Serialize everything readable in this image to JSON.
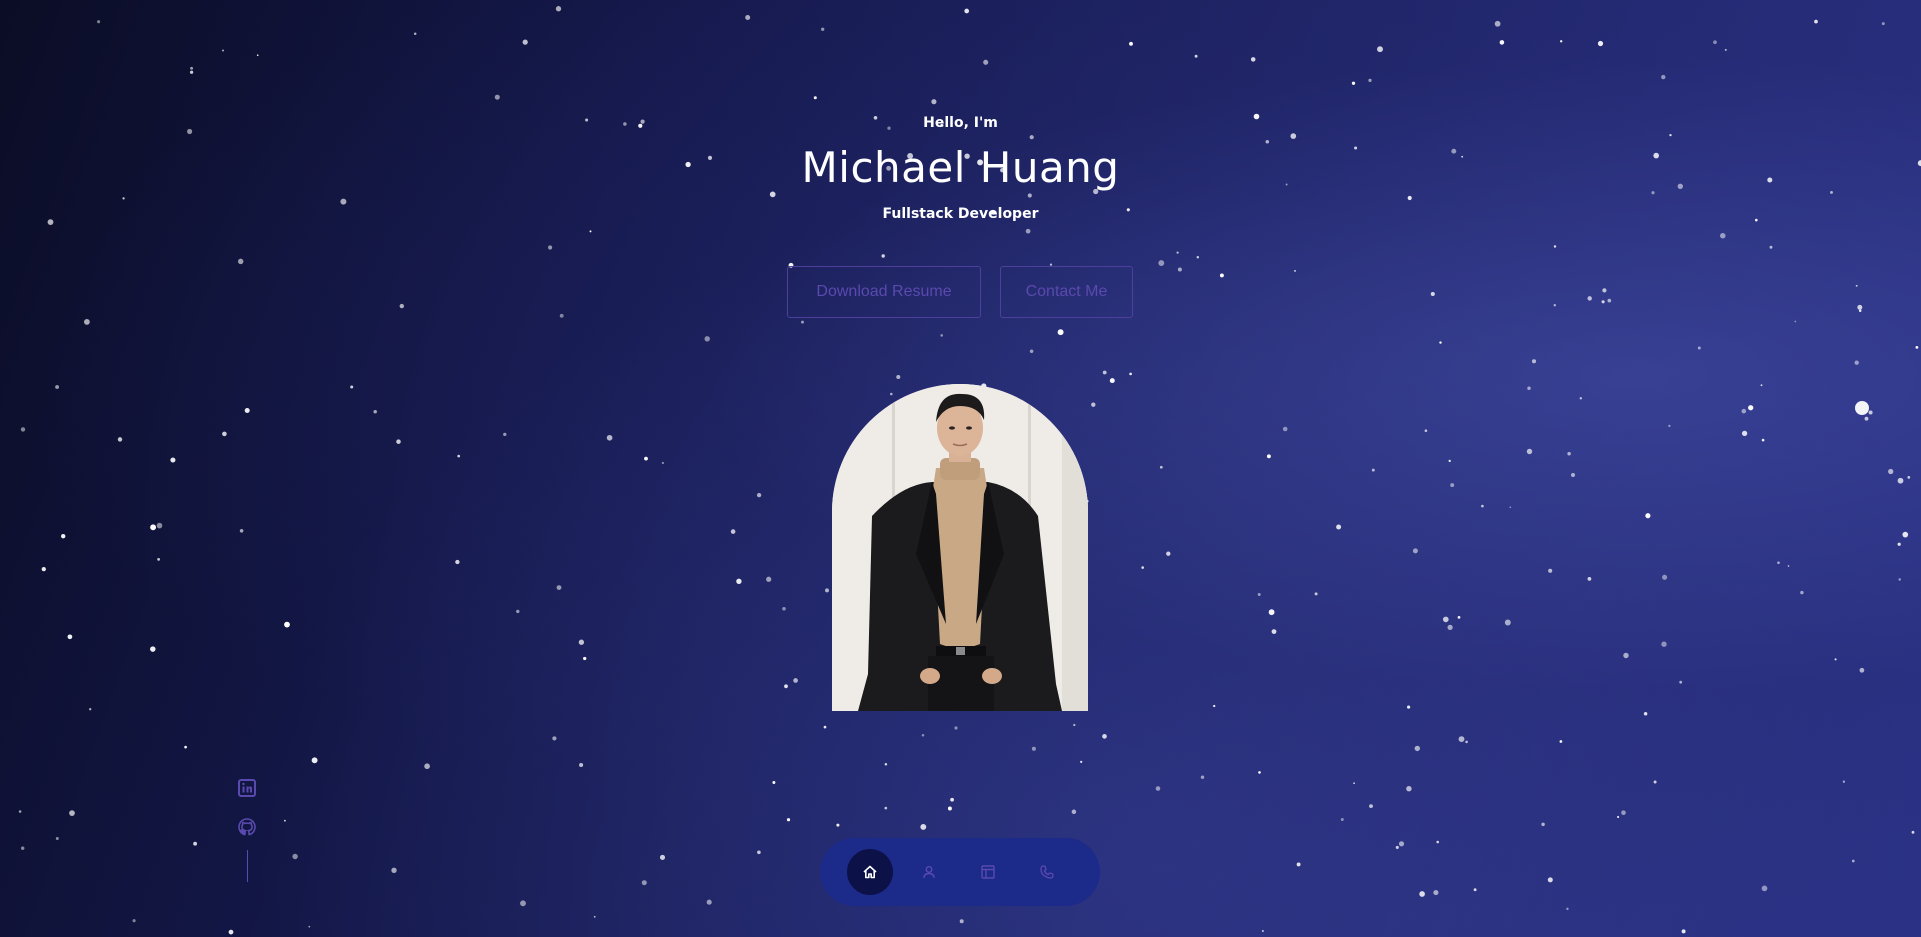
{
  "hero": {
    "greeting": "Hello, I'm",
    "name": "Michael Huang",
    "role": "Fullstack Developer"
  },
  "buttons": {
    "download_resume": "Download Resume",
    "contact_me": "Contact Me"
  },
  "portrait": {
    "alt": "Michael Huang portrait"
  },
  "socials": [
    {
      "icon": "linkedin-icon"
    },
    {
      "icon": "github-icon"
    }
  ],
  "nav": {
    "items": [
      {
        "icon": "home-icon",
        "active": true
      },
      {
        "icon": "user-icon",
        "active": false
      },
      {
        "icon": "portfolio-icon",
        "active": false
      },
      {
        "icon": "phone-icon",
        "active": false
      }
    ]
  },
  "colors": {
    "accent": "#5a49ae",
    "nav_background": "#1c2a8a",
    "nav_active": "#0c1148",
    "text": "#ffffff"
  }
}
